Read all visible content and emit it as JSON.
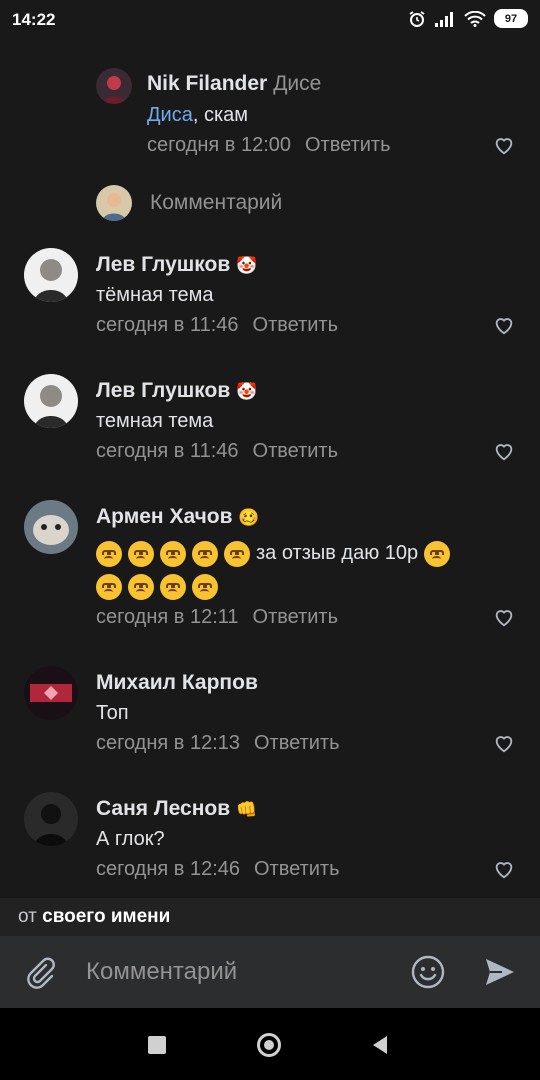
{
  "status": {
    "time": "14:22",
    "battery": "97"
  },
  "comments": [
    {
      "name": "Nik Filander",
      "reply_to": "Дисе",
      "text_link": "Диса",
      "text": ", скам",
      "time": "сегодня в 12:00",
      "reply": "Ответить"
    },
    {
      "name": "Лев Глушков",
      "text": "тёмная тема",
      "time": "сегодня в 11:46",
      "reply": "Ответить"
    },
    {
      "name": "Лев Глушков",
      "text": "темная тема",
      "time": "сегодня в 11:46",
      "reply": "Ответить"
    },
    {
      "name": "Армен Хачов",
      "text": "за отзыв даю 10р",
      "time": "сегодня в 12:11",
      "reply": "Ответить"
    },
    {
      "name": "Михаил Карпов",
      "text": "Топ",
      "time": "сегодня в 12:13",
      "reply": "Ответить"
    },
    {
      "name": "Саня Леснов",
      "text": "А глок?",
      "time": "сегодня в 12:46",
      "reply": "Ответить"
    }
  ],
  "inline_reply": {
    "placeholder": "Комментарий"
  },
  "from": {
    "prefix": "от",
    "value": "своего имени"
  },
  "composer": {
    "placeholder": "Комментарий"
  }
}
